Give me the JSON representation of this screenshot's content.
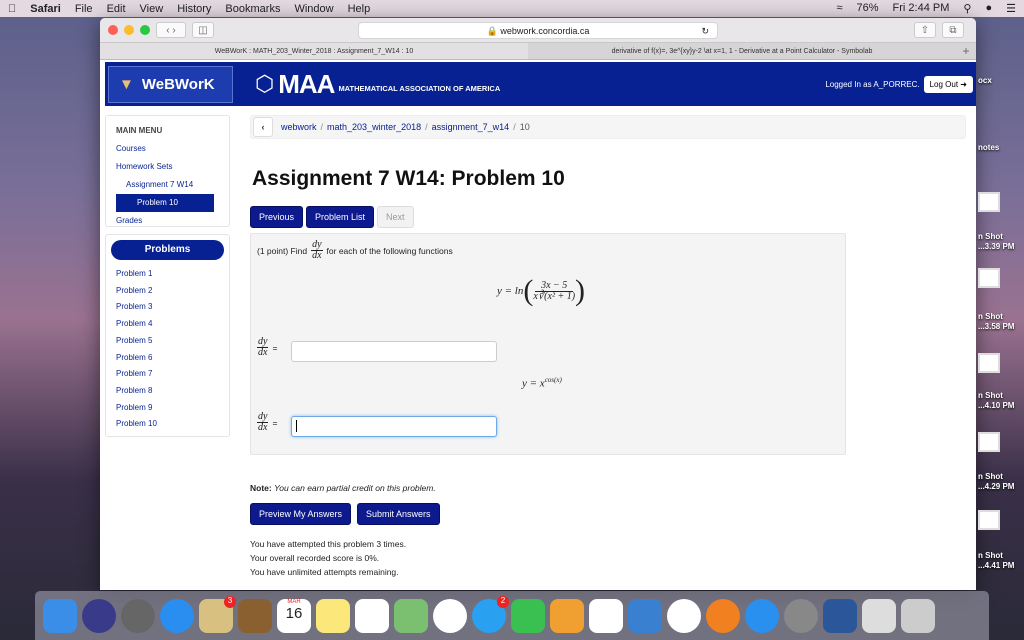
{
  "menubar": {
    "app": "Safari",
    "items": [
      "File",
      "Edit",
      "View",
      "History",
      "Bookmarks",
      "Window",
      "Help"
    ],
    "battery": "76%",
    "clock": "Fri 2:44 PM"
  },
  "browser": {
    "url": "webwork.concordia.ca",
    "tabs": [
      "WeBWorK : MATH_203_Winter_2018 : Assignment_7_W14 : 10",
      "derivative of f(x)=, 3e^{xy}y-2 \\at x=1, 1 - Derivative at a Point Calculator - Symbolab"
    ],
    "new_tab": "+"
  },
  "header": {
    "logo": "WeBWorK",
    "maa": "MAA",
    "maa_full": "MATHEMATICAL ASSOCIATION OF AMERICA",
    "logged_in": "Logged In as A_PORREC.",
    "logout": "Log Out"
  },
  "sidebar": {
    "title": "MAIN MENU",
    "courses": "Courses",
    "homework_sets": "Homework Sets",
    "assignment": "Assignment 7 W14",
    "problem": "Problem 10",
    "grades": "Grades",
    "problems_title": "Problems",
    "problems": [
      "Problem 1",
      "Problem 2",
      "Problem 3",
      "Problem 4",
      "Problem 5",
      "Problem 6",
      "Problem 7",
      "Problem 8",
      "Problem 9",
      "Problem 10"
    ]
  },
  "breadcrumb": [
    "webwork",
    "math_203_winter_2018",
    "assignment_7_w14",
    "10"
  ],
  "page_title": "Assignment 7 W14: Problem 10",
  "nav": {
    "previous": "Previous",
    "problem_list": "Problem List",
    "next": "Next"
  },
  "problem": {
    "intro_pre": "(1 point) Find",
    "intro_post": "for each of the following functions",
    "dy": "dy",
    "dx": "dx",
    "eq1_lhs": "y = ln",
    "eq1_num": "3x − 5",
    "eq1_den": "x∛(x² + 1)",
    "eq2_lhs": "y = x",
    "eq2_exp": "cos(x)",
    "equals": "=",
    "answer1": "",
    "answer2": ""
  },
  "note": {
    "label": "Note:",
    "text": "You can earn partial credit on this problem."
  },
  "buttons": {
    "preview": "Preview My Answers",
    "submit": "Submit Answers"
  },
  "status": [
    "You have attempted this problem 3 times.",
    "Your overall recorded score is 0%.",
    "You have unlimited attempts remaining."
  ],
  "desktop": [
    "ocx",
    "ocx",
    "notes",
    "n Shot",
    "...3.39 PM",
    "n Shot",
    "...3.58 PM",
    "n Shot",
    "...4.10 PM",
    "n Shot",
    "...4.29 PM",
    "n Shot",
    "...4.41 PM"
  ],
  "dock": {
    "calendar_month": "MAR",
    "calendar_day": "16",
    "badges": [
      "3",
      "2"
    ]
  }
}
